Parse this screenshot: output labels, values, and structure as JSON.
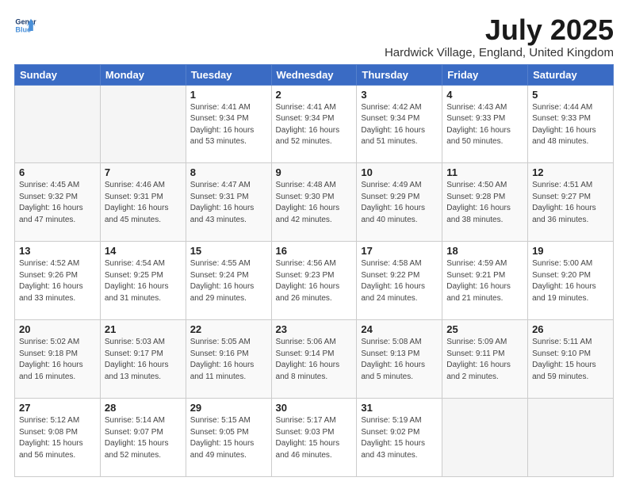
{
  "header": {
    "logo_line1": "General",
    "logo_line2": "Blue",
    "title": "July 2025",
    "subtitle": "Hardwick Village, England, United Kingdom"
  },
  "weekdays": [
    "Sunday",
    "Monday",
    "Tuesday",
    "Wednesday",
    "Thursday",
    "Friday",
    "Saturday"
  ],
  "weeks": [
    [
      {
        "day": "",
        "info": ""
      },
      {
        "day": "",
        "info": ""
      },
      {
        "day": "1",
        "info": "Sunrise: 4:41 AM\nSunset: 9:34 PM\nDaylight: 16 hours\nand 53 minutes."
      },
      {
        "day": "2",
        "info": "Sunrise: 4:41 AM\nSunset: 9:34 PM\nDaylight: 16 hours\nand 52 minutes."
      },
      {
        "day": "3",
        "info": "Sunrise: 4:42 AM\nSunset: 9:34 PM\nDaylight: 16 hours\nand 51 minutes."
      },
      {
        "day": "4",
        "info": "Sunrise: 4:43 AM\nSunset: 9:33 PM\nDaylight: 16 hours\nand 50 minutes."
      },
      {
        "day": "5",
        "info": "Sunrise: 4:44 AM\nSunset: 9:33 PM\nDaylight: 16 hours\nand 48 minutes."
      }
    ],
    [
      {
        "day": "6",
        "info": "Sunrise: 4:45 AM\nSunset: 9:32 PM\nDaylight: 16 hours\nand 47 minutes."
      },
      {
        "day": "7",
        "info": "Sunrise: 4:46 AM\nSunset: 9:31 PM\nDaylight: 16 hours\nand 45 minutes."
      },
      {
        "day": "8",
        "info": "Sunrise: 4:47 AM\nSunset: 9:31 PM\nDaylight: 16 hours\nand 43 minutes."
      },
      {
        "day": "9",
        "info": "Sunrise: 4:48 AM\nSunset: 9:30 PM\nDaylight: 16 hours\nand 42 minutes."
      },
      {
        "day": "10",
        "info": "Sunrise: 4:49 AM\nSunset: 9:29 PM\nDaylight: 16 hours\nand 40 minutes."
      },
      {
        "day": "11",
        "info": "Sunrise: 4:50 AM\nSunset: 9:28 PM\nDaylight: 16 hours\nand 38 minutes."
      },
      {
        "day": "12",
        "info": "Sunrise: 4:51 AM\nSunset: 9:27 PM\nDaylight: 16 hours\nand 36 minutes."
      }
    ],
    [
      {
        "day": "13",
        "info": "Sunrise: 4:52 AM\nSunset: 9:26 PM\nDaylight: 16 hours\nand 33 minutes."
      },
      {
        "day": "14",
        "info": "Sunrise: 4:54 AM\nSunset: 9:25 PM\nDaylight: 16 hours\nand 31 minutes."
      },
      {
        "day": "15",
        "info": "Sunrise: 4:55 AM\nSunset: 9:24 PM\nDaylight: 16 hours\nand 29 minutes."
      },
      {
        "day": "16",
        "info": "Sunrise: 4:56 AM\nSunset: 9:23 PM\nDaylight: 16 hours\nand 26 minutes."
      },
      {
        "day": "17",
        "info": "Sunrise: 4:58 AM\nSunset: 9:22 PM\nDaylight: 16 hours\nand 24 minutes."
      },
      {
        "day": "18",
        "info": "Sunrise: 4:59 AM\nSunset: 9:21 PM\nDaylight: 16 hours\nand 21 minutes."
      },
      {
        "day": "19",
        "info": "Sunrise: 5:00 AM\nSunset: 9:20 PM\nDaylight: 16 hours\nand 19 minutes."
      }
    ],
    [
      {
        "day": "20",
        "info": "Sunrise: 5:02 AM\nSunset: 9:18 PM\nDaylight: 16 hours\nand 16 minutes."
      },
      {
        "day": "21",
        "info": "Sunrise: 5:03 AM\nSunset: 9:17 PM\nDaylight: 16 hours\nand 13 minutes."
      },
      {
        "day": "22",
        "info": "Sunrise: 5:05 AM\nSunset: 9:16 PM\nDaylight: 16 hours\nand 11 minutes."
      },
      {
        "day": "23",
        "info": "Sunrise: 5:06 AM\nSunset: 9:14 PM\nDaylight: 16 hours\nand 8 minutes."
      },
      {
        "day": "24",
        "info": "Sunrise: 5:08 AM\nSunset: 9:13 PM\nDaylight: 16 hours\nand 5 minutes."
      },
      {
        "day": "25",
        "info": "Sunrise: 5:09 AM\nSunset: 9:11 PM\nDaylight: 16 hours\nand 2 minutes."
      },
      {
        "day": "26",
        "info": "Sunrise: 5:11 AM\nSunset: 9:10 PM\nDaylight: 15 hours\nand 59 minutes."
      }
    ],
    [
      {
        "day": "27",
        "info": "Sunrise: 5:12 AM\nSunset: 9:08 PM\nDaylight: 15 hours\nand 56 minutes."
      },
      {
        "day": "28",
        "info": "Sunrise: 5:14 AM\nSunset: 9:07 PM\nDaylight: 15 hours\nand 52 minutes."
      },
      {
        "day": "29",
        "info": "Sunrise: 5:15 AM\nSunset: 9:05 PM\nDaylight: 15 hours\nand 49 minutes."
      },
      {
        "day": "30",
        "info": "Sunrise: 5:17 AM\nSunset: 9:03 PM\nDaylight: 15 hours\nand 46 minutes."
      },
      {
        "day": "31",
        "info": "Sunrise: 5:19 AM\nSunset: 9:02 PM\nDaylight: 15 hours\nand 43 minutes."
      },
      {
        "day": "",
        "info": ""
      },
      {
        "day": "",
        "info": ""
      }
    ]
  ]
}
